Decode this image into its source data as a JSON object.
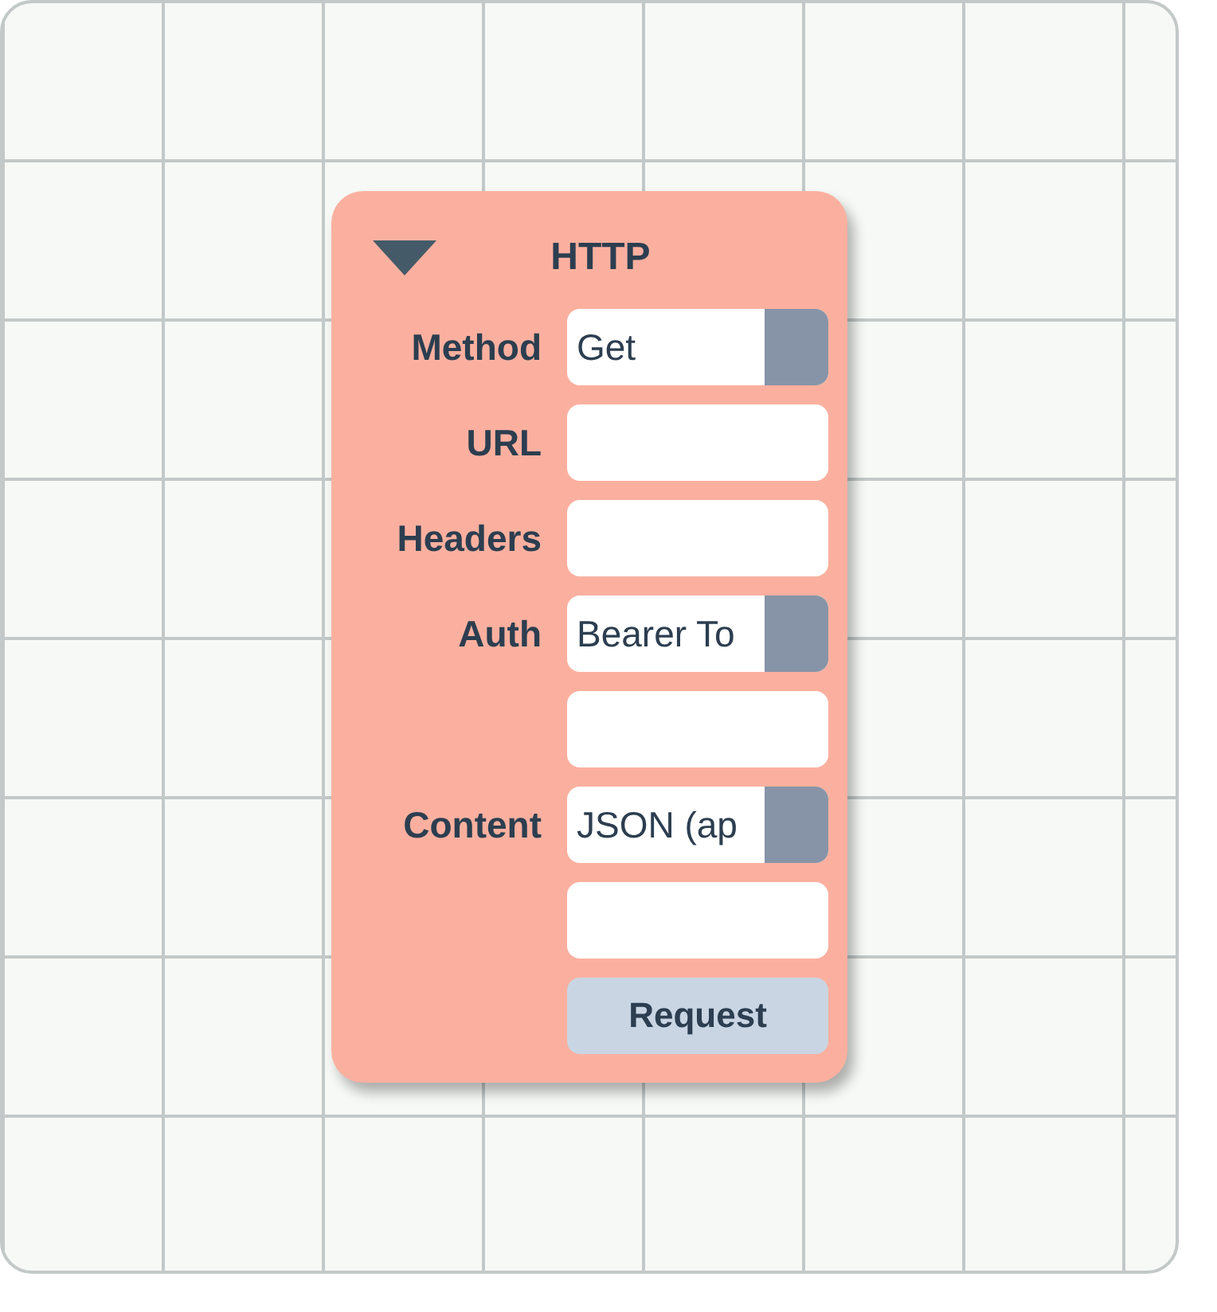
{
  "node": {
    "title": "HTTP",
    "expanded": true,
    "rows": [
      {
        "kind": "select",
        "label": "Method",
        "value": "Get"
      },
      {
        "kind": "text",
        "label": "URL"
      },
      {
        "kind": "text",
        "label": "Headers"
      },
      {
        "kind": "select",
        "label": "Auth",
        "value": "Bearer To"
      },
      {
        "kind": "text"
      },
      {
        "kind": "select",
        "label": "Content",
        "value": "JSON (ap"
      },
      {
        "kind": "text"
      },
      {
        "kind": "button",
        "text": "Request"
      }
    ]
  }
}
